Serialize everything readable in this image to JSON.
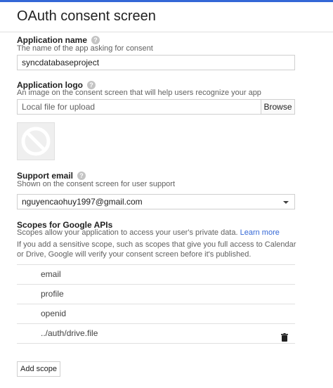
{
  "header": {
    "title": "OAuth consent screen"
  },
  "app_name": {
    "label": "Application name",
    "description": "The name of the app asking for consent",
    "value": "syncdatabaseproject"
  },
  "app_logo": {
    "label": "Application logo",
    "description": "An image on the consent screen that will help users recognize your app",
    "file_placeholder": "Local file for upload",
    "browse_label": "Browse"
  },
  "support_email": {
    "label": "Support email",
    "description": "Shown on the consent screen for user support",
    "value": "nguyencaohuy1997@gmail.com"
  },
  "scopes": {
    "label": "Scopes for Google APIs",
    "description": "Scopes allow your application to access your user's private data.",
    "learn_more": "Learn more",
    "note": "If you add a sensitive scope, such as scopes that give you full access to Calendar or Drive, Google will verify your consent screen before it's published.",
    "items": [
      {
        "name": "email"
      },
      {
        "name": "profile"
      },
      {
        "name": "openid"
      },
      {
        "name": "../auth/drive.file"
      }
    ],
    "add_label": "Add scope"
  },
  "help_glyph": "?"
}
